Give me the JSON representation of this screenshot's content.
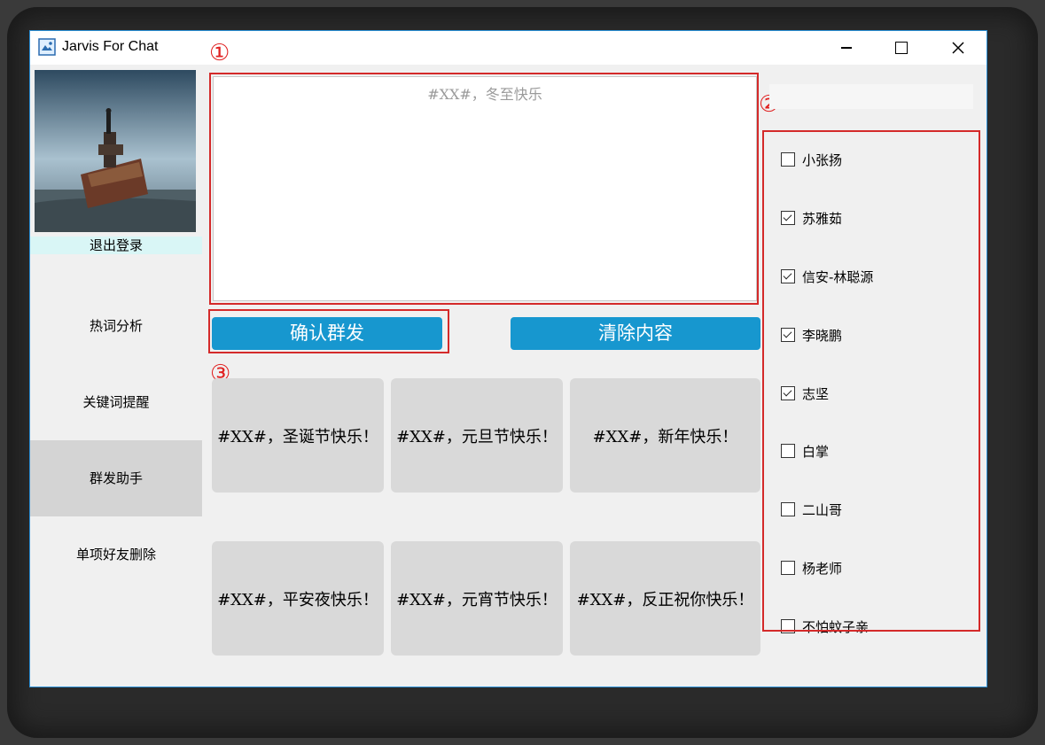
{
  "window": {
    "title": "Jarvis For Chat"
  },
  "sidebar": {
    "logout_label": "退出登录",
    "items": [
      {
        "label": "热词分析",
        "active": false
      },
      {
        "label": "关键词提醒",
        "active": false
      },
      {
        "label": "群发助手",
        "active": true
      },
      {
        "label": "单项好友删除",
        "active": false
      }
    ]
  },
  "annotations": {
    "marker1": "①",
    "marker2": "②",
    "marker3": "③"
  },
  "message": {
    "text": "#XX#，冬至快乐"
  },
  "buttons": {
    "send_label": "确认群发",
    "clear_label": "清除内容"
  },
  "templates": [
    "#XX#，圣诞节快乐！",
    "#XX#，元旦节快乐！",
    "#XX#，新年快乐！",
    "#XX#，平安夜快乐！",
    "#XX#，元宵节快乐！",
    "#XX#，反正祝你快乐！"
  ],
  "contacts": [
    {
      "name": "小张扬",
      "checked": false
    },
    {
      "name": "苏雅茹",
      "checked": true
    },
    {
      "name": "信安-林聪源",
      "checked": true
    },
    {
      "name": "李晓鹏",
      "checked": true
    },
    {
      "name": "志坚",
      "checked": true
    },
    {
      "name": "白掌",
      "checked": false
    },
    {
      "name": "二山哥",
      "checked": false
    },
    {
      "name": "杨老师",
      "checked": false
    },
    {
      "name": "不怕蚊子亲",
      "checked": false
    }
  ],
  "colors": {
    "accent": "#1797cf",
    "annotation_red": "#d42a2a",
    "active_nav": "#d4d4d4",
    "logout_bg": "#d9f6f6"
  }
}
